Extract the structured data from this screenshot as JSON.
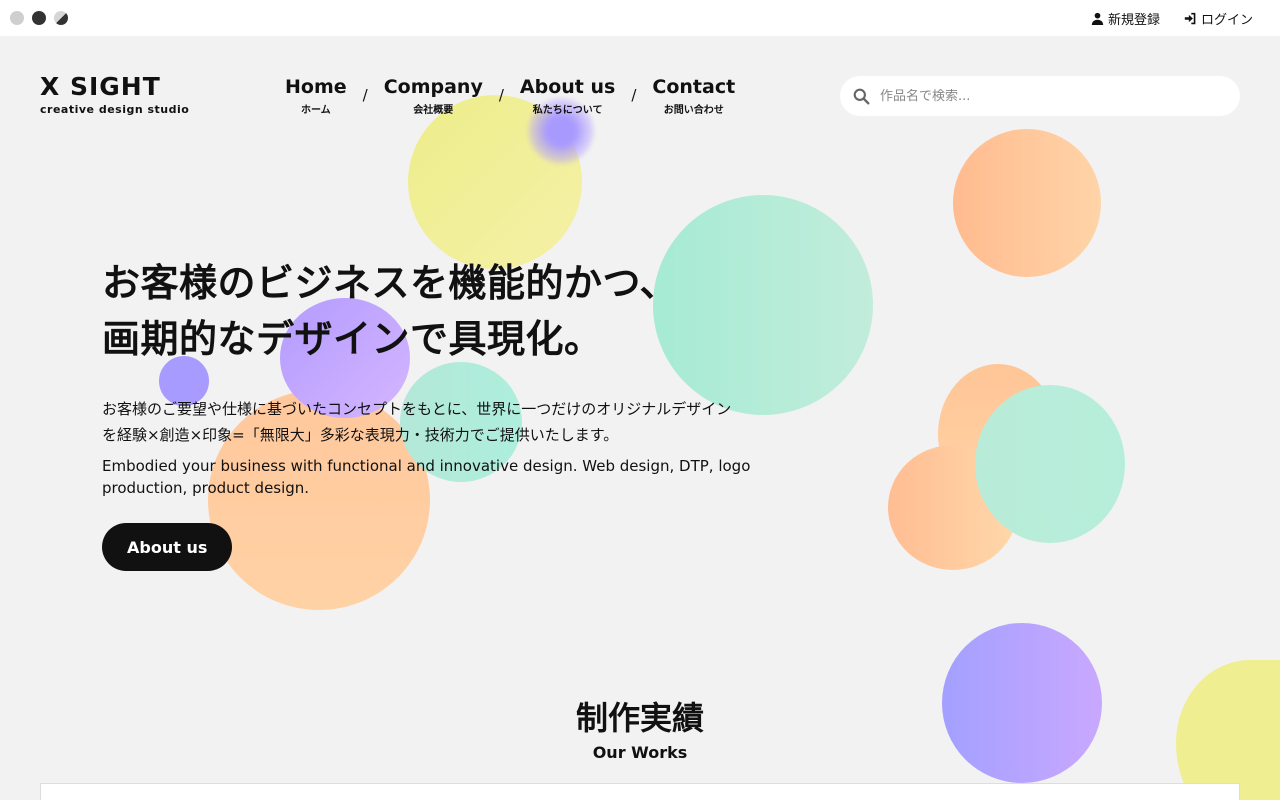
{
  "topbar": {
    "theme_options": [
      "light-theme",
      "dark-theme",
      "auto-theme"
    ],
    "signup_label": "新規登録",
    "login_label": "ログイン",
    "signup_icon": "user-icon",
    "login_icon": "sign-in-icon"
  },
  "logo": {
    "main": "X SIGHT",
    "sub": "creative design studio"
  },
  "nav": {
    "items": [
      {
        "en": "Home",
        "ja": "ホーム"
      },
      {
        "en": "Company",
        "ja": "会社概要"
      },
      {
        "en": "About us",
        "ja": "私たちについて"
      },
      {
        "en": "Contact",
        "ja": "お問い合わせ"
      }
    ],
    "separator": "/"
  },
  "search": {
    "placeholder": "作品名で検索...",
    "icon": "search-icon"
  },
  "hero": {
    "title_line1": "お客様のビジネスを機能的かつ、",
    "title_line2": "画期的なデザインで具現化。",
    "desc_ja_line1": "お客様のご要望や仕様に基づいたコンセプトをもとに、世界に一つだけのオリジナルデザイン",
    "desc_ja_line2": "を経験×創造×印象=「無限大」多彩な表現力・技術力でご提供いたします。",
    "desc_en": "Embodied your business with functional and innovative design. Web design, DTP, logo production, product design.",
    "button_label": "About us"
  },
  "works": {
    "title": "制作実績",
    "subtitle": "Our Works"
  }
}
